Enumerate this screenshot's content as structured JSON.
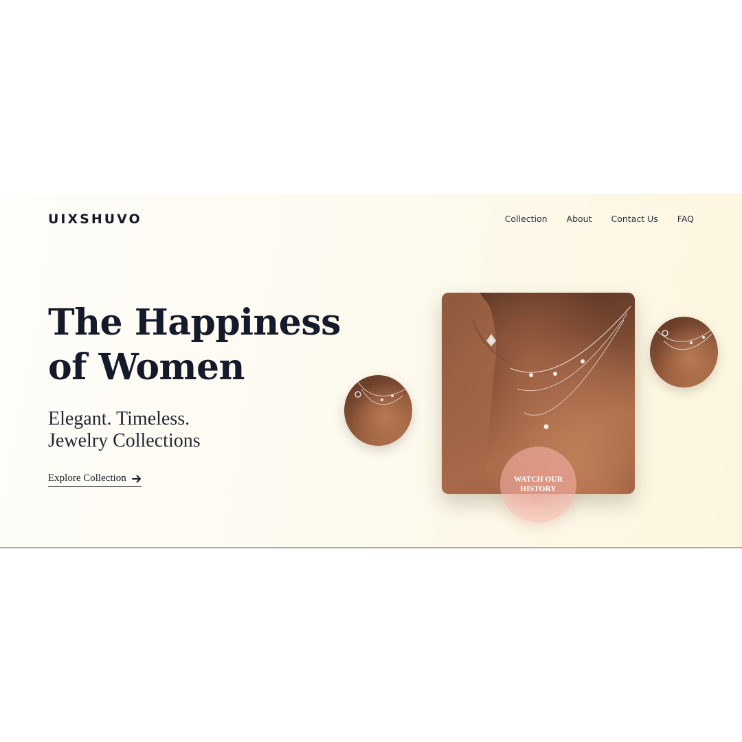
{
  "brand": {
    "logo": "UIXSHUVO"
  },
  "nav": {
    "items": [
      "Collection",
      "About",
      "Contact Us",
      "FAQ"
    ]
  },
  "hero": {
    "headline": "The Happiness of Women",
    "subline_1": "Elegant. Timeless.",
    "subline_2": "Jewelry Collections",
    "cta_label": "Explore Collection",
    "watch_label": "WATCH OUR HISTORY"
  },
  "icons": {
    "cta_arrow": "arrow-right-icon"
  },
  "colors": {
    "text_dark": "#141a2a",
    "hero_bg": "#fdf8e6",
    "accent_pink": "#f0a89d",
    "skin": "#8e5638"
  }
}
